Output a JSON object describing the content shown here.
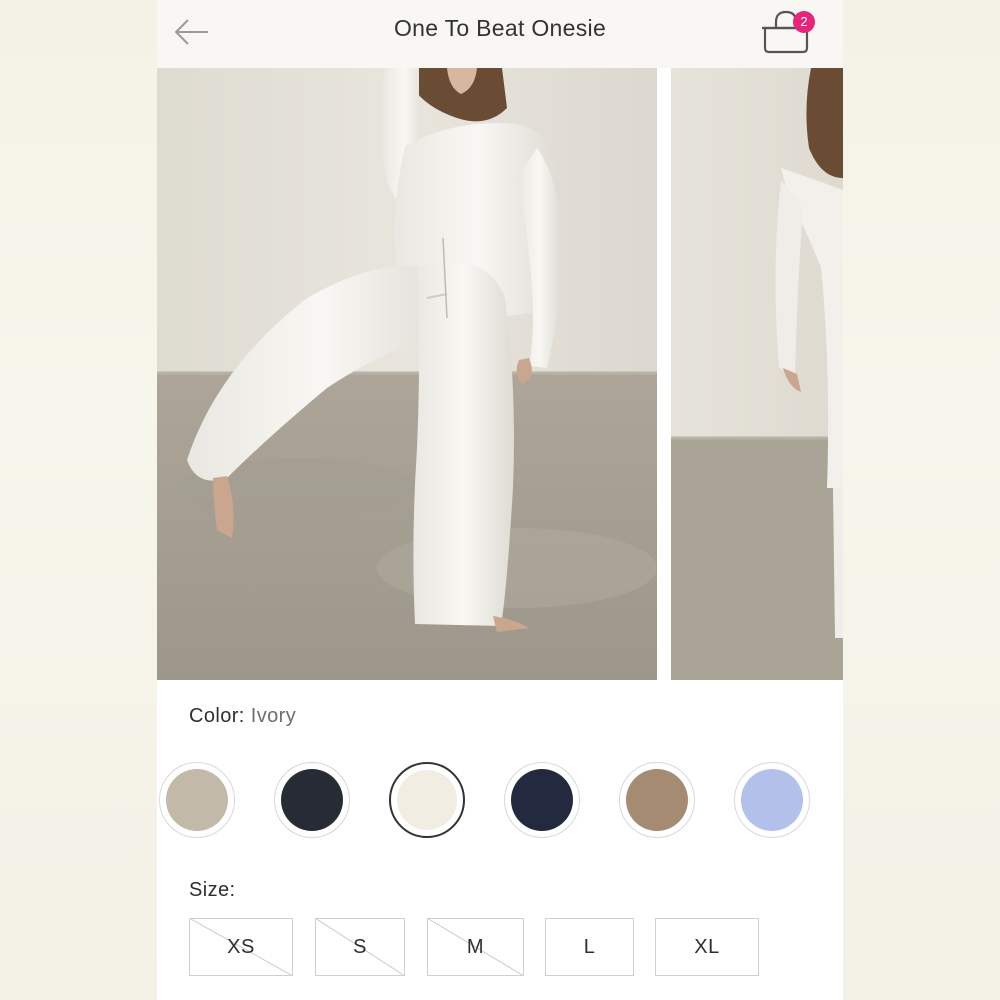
{
  "header": {
    "title": "One To Beat Onesie",
    "cart_count": "2"
  },
  "gallery": {
    "images": [
      "product-photo-main",
      "product-photo-secondary"
    ]
  },
  "color": {
    "label": "Color:",
    "selected": "Ivory",
    "swatches": [
      {
        "name": "taupe-swatch",
        "color": "#c3b9a8",
        "selected": false
      },
      {
        "name": "black-swatch",
        "color": "#272b36",
        "selected": false
      },
      {
        "name": "ivory-swatch",
        "color": "#f1ede2",
        "selected": true
      },
      {
        "name": "navy-swatch",
        "color": "#232a40",
        "selected": false
      },
      {
        "name": "camel-swatch",
        "color": "#a58b72",
        "selected": false
      },
      {
        "name": "lavender-swatch",
        "color": "#b3c0ea",
        "selected": false
      }
    ]
  },
  "size": {
    "label": "Size:",
    "options": [
      {
        "label": "XS",
        "sold_out": true
      },
      {
        "label": "S",
        "sold_out": true
      },
      {
        "label": "M",
        "sold_out": true
      },
      {
        "label": "L",
        "sold_out": false
      },
      {
        "label": "XL",
        "sold_out": false
      }
    ]
  },
  "colors": {
    "badge": "#e6247a",
    "header_bg": "#f8f7f4"
  }
}
